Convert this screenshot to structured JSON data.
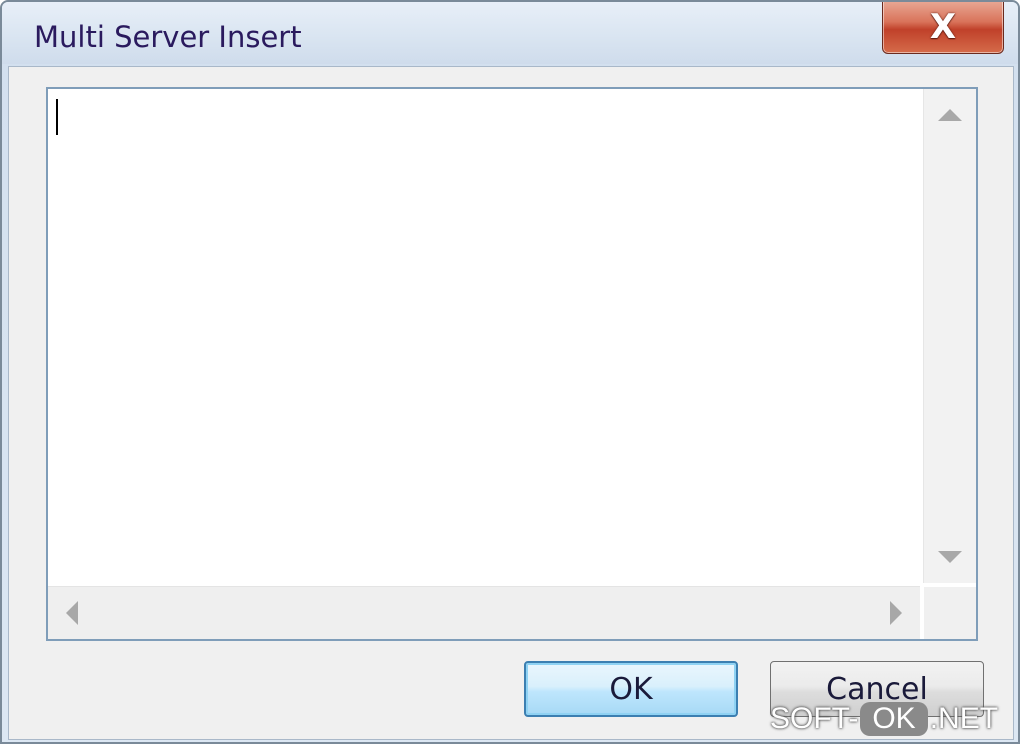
{
  "window": {
    "title": "Multi Server Insert",
    "close_label": "X"
  },
  "editor": {
    "value": ""
  },
  "scrollbars": {
    "vertical_up": "up-arrow-icon",
    "vertical_down": "down-arrow-icon",
    "horizontal_left": "left-arrow-icon",
    "horizontal_right": "right-arrow-icon"
  },
  "buttons": {
    "ok_label": "OK",
    "cancel_label": "Cancel"
  },
  "watermark": {
    "prefix": "SOFT-",
    "highlight": "OK",
    "suffix": ".NET"
  },
  "colors": {
    "title_text": "#2a1a5e",
    "close_button": "#c0412a",
    "ok_border": "#3c7fb1",
    "textbox_border": "#7f9db9"
  }
}
